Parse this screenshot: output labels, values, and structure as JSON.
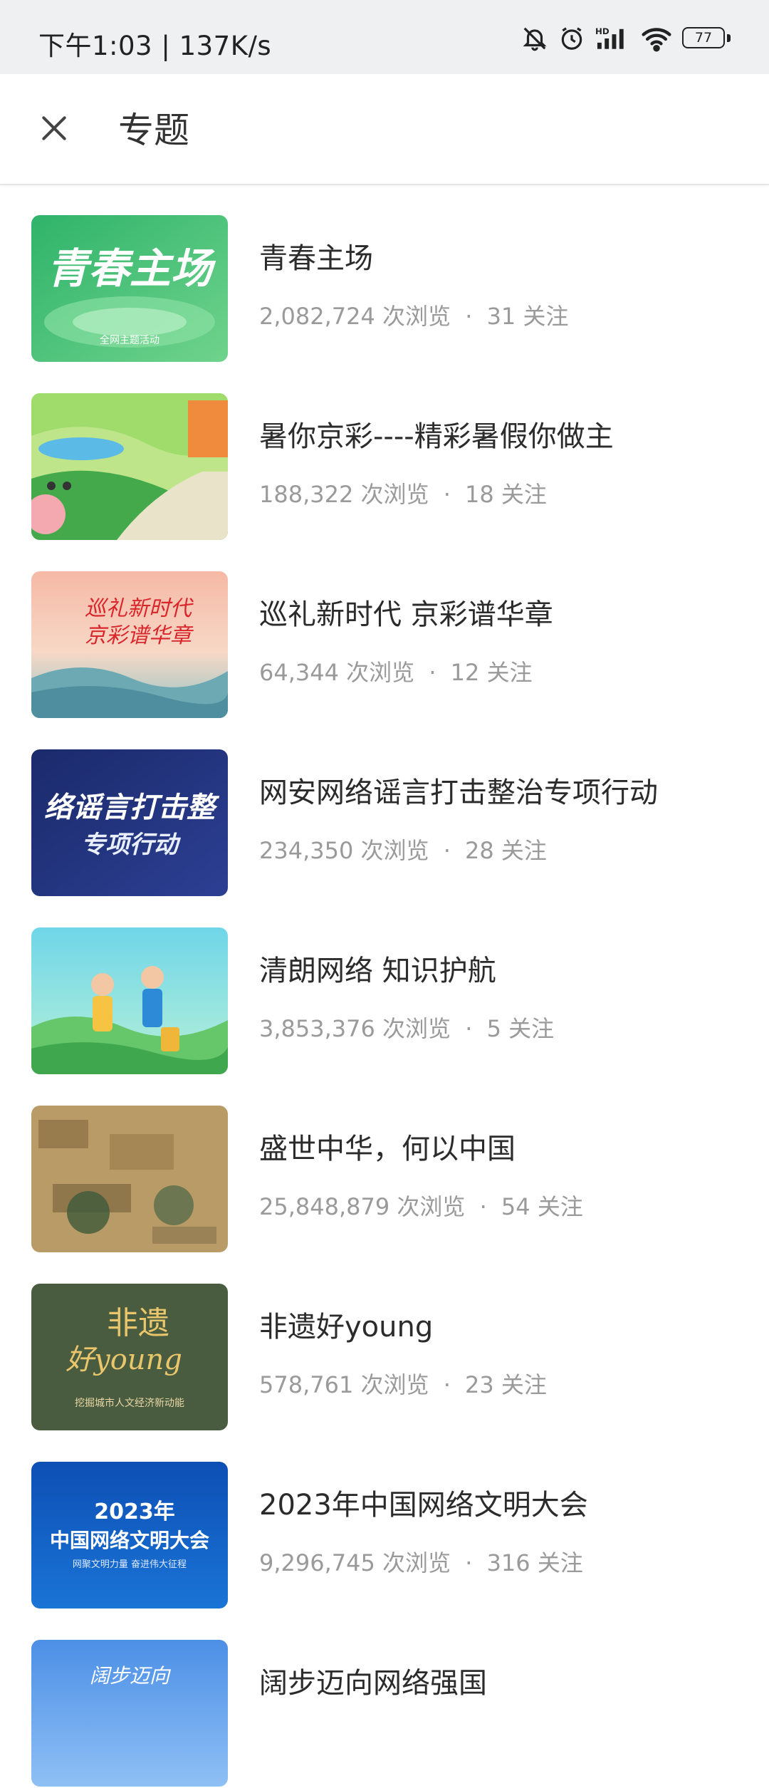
{
  "status_bar": {
    "time": "下午1:03 | 137K/s",
    "battery": "77",
    "icons": [
      "bell-off-icon",
      "alarm-icon",
      "hd-signal-icon",
      "wifi-icon",
      "battery-icon"
    ]
  },
  "header": {
    "close_icon": "close-icon",
    "title": "专题"
  },
  "meta_labels": {
    "views": "次浏览",
    "follows": "关注",
    "separator": "·"
  },
  "topics": [
    {
      "title": "青春主场",
      "views": "2,082,724",
      "follows": "31",
      "thumb_text": "青春主场",
      "thumb_sub": "全网主题活动"
    },
    {
      "title": "暑你京彩----精彩暑假你做主",
      "views": "188,322",
      "follows": "18"
    },
    {
      "title": "巡礼新时代 京彩谱华章",
      "views": "64,344",
      "follows": "12",
      "thumb_text": "巡礼新时代",
      "thumb_text2": "京彩谱华章"
    },
    {
      "title": "网安网络谣言打击整治专项行动",
      "views": "234,350",
      "follows": "28",
      "thumb_text": "络谣言打击整",
      "thumb_text2": "专项行动"
    },
    {
      "title": "清朗网络 知识护航",
      "views": "3,853,376",
      "follows": "5"
    },
    {
      "title": "盛世中华，何以中国",
      "views": "25,848,879",
      "follows": "54"
    },
    {
      "title": "非遗好young",
      "views": "578,761",
      "follows": "23",
      "thumb_text": "非遗",
      "thumb_text2": "好young",
      "thumb_sub": "挖掘城市人文经济新动能"
    },
    {
      "title": "2023年中国网络文明大会",
      "views": "9,296,745",
      "follows": "316",
      "thumb_text": "2023年",
      "thumb_text2": "中国网络文明大会",
      "thumb_sub": "网聚文明力量  奋进伟大征程"
    },
    {
      "title": "阔步迈向网络强国",
      "views": "",
      "follows": "",
      "thumb_text": "阔步迈向"
    }
  ]
}
